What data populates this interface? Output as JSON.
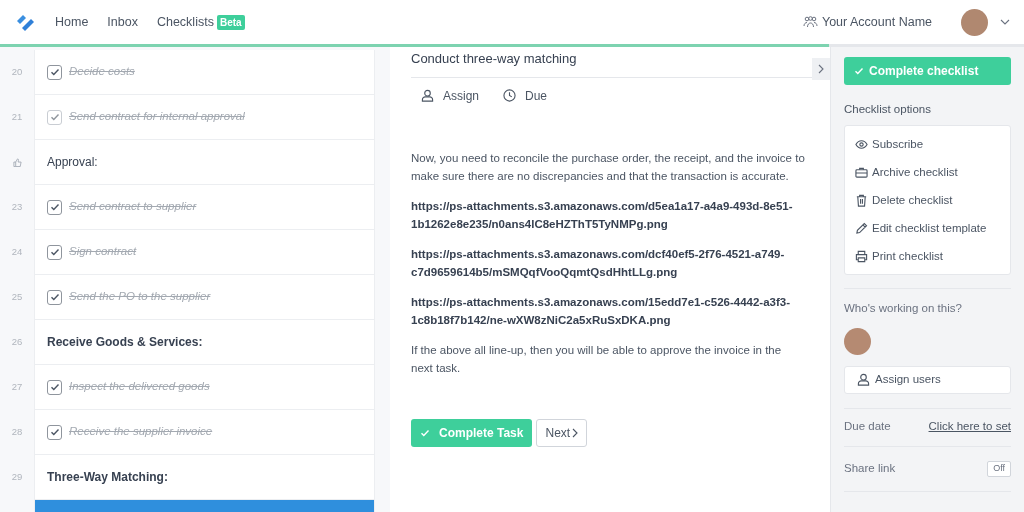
{
  "nav": {
    "links": [
      {
        "label": "Home"
      },
      {
        "label": "Inbox"
      },
      {
        "label": "Checklists",
        "badge": "Beta"
      }
    ],
    "account": "Your Account Name"
  },
  "progress": {
    "level": 0.81
  },
  "checklist": {
    "items": [
      {
        "kind": "task",
        "number": "20",
        "text": "Decide costs",
        "checked": true,
        "muted": false,
        "selected": false
      },
      {
        "kind": "task",
        "number": "21",
        "text": "Send contract for internal approval",
        "checked": true,
        "muted": true,
        "selected": false
      },
      {
        "kind": "approval",
        "text": "Approval:",
        "selected": false
      },
      {
        "kind": "task",
        "number": "23",
        "text": "Send contract to supplier",
        "checked": true,
        "muted": false,
        "selected": false
      },
      {
        "kind": "task",
        "number": "24",
        "text": "Sign contract",
        "checked": true,
        "muted": false,
        "selected": false
      },
      {
        "kind": "task",
        "number": "25",
        "text": "Send the PO to the supplier",
        "checked": true,
        "muted": false,
        "selected": false
      },
      {
        "kind": "heading",
        "number": "26",
        "text": "Receive Goods & Services:",
        "selected": false
      },
      {
        "kind": "task",
        "number": "27",
        "text": "Inspect the delivered goods",
        "checked": true,
        "muted": false,
        "selected": false
      },
      {
        "kind": "task",
        "number": "28",
        "text": "Receive the supplier invoice",
        "checked": true,
        "muted": false,
        "selected": false
      },
      {
        "kind": "heading",
        "number": "29",
        "text": "Three-Way Matching:",
        "selected": false
      },
      {
        "kind": "task",
        "selected": true
      }
    ]
  },
  "task": {
    "title": "Conduct three-way matching",
    "actions": [
      {
        "kind": "assign",
        "label": "Assign"
      },
      {
        "kind": "due",
        "label": "Due"
      }
    ],
    "body": [
      {
        "kind": "paragraph",
        "text": "Now, you need to reconcile the purchase order, the receipt, and the invoice to make sure there are no discrepancies and that the transaction is accurate."
      },
      {
        "kind": "link",
        "text": "https://ps-attachments.s3.amazonaws.com/d5ea1a17-a4a9-493d-8e51-1b1262e8e235/n0ans4lC8eHZThT5TyNMPg.png"
      },
      {
        "kind": "link",
        "text": "https://ps-attachments.s3.amazonaws.com/dcf40ef5-2f76-4521-a749-c7d9659614b5/mSMQqfVooQqmtQsdHhtLLg.png"
      },
      {
        "kind": "link",
        "text": "https://ps-attachments.s3.amazonaws.com/15edd7e1-c526-4442-a3f3-1c8b18f7b142/ne-wXW8zNiC2a5xRuSxDKA.png"
      },
      {
        "kind": "paragraph",
        "text": "If the above all line-up, then you will be able to approve the invoice in the next task."
      }
    ],
    "complete_button": "Complete Task",
    "next_button": "Next"
  },
  "sidebar": {
    "complete_button": "Complete checklist",
    "options_title": "Checklist options",
    "options": [
      {
        "kind": "subscribe",
        "label": "Subscribe"
      },
      {
        "kind": "archive",
        "label": "Archive checklist"
      },
      {
        "kind": "delete",
        "label": "Delete checklist"
      },
      {
        "kind": "edit",
        "label": "Edit checklist template"
      },
      {
        "kind": "print",
        "label": "Print checklist"
      }
    ],
    "working_title": "Who's working on this?",
    "assign_button": "Assign users",
    "due_label": "Due date",
    "due_link": "Click here to set",
    "share_label": "Share link",
    "share_toggle": {
      "label": "Off",
      "on": false
    }
  }
}
